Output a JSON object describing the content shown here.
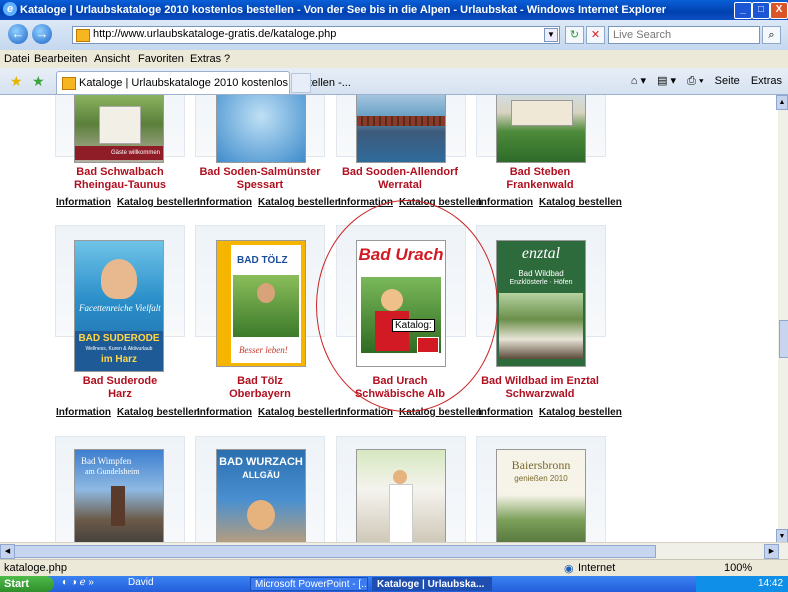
{
  "window": {
    "title": "Kataloge | Urlaubskataloge 2010 kostenlos bestellen - Von der See bis in die Alpen - Urlaubskat - Windows Internet Explorer"
  },
  "address": {
    "url": "http://www.urlaubskataloge-gratis.de/kataloge.php",
    "search_placeholder": "Live Search"
  },
  "menu": [
    "Datei",
    "Bearbeiten",
    "Ansicht",
    "Favoriten",
    "Extras",
    "?"
  ],
  "tab": {
    "label": "Kataloge | Urlaubskataloge 2010 kostenlos bestellen -..."
  },
  "toolbar": {
    "page": "Seite",
    "extras": "Extras"
  },
  "links": {
    "info": "Information",
    "order": "Katalog bestellen"
  },
  "row1": [
    {
      "name1": "Bad Schwalbach",
      "name2": "Rheingau-Taunus"
    },
    {
      "name1": "Bad Soden-Salmünster",
      "name2": "Spessart"
    },
    {
      "name1": "Bad Sooden-Allendorf",
      "name2": "Werratal"
    },
    {
      "name1": "Bad Steben",
      "name2": "Frankenwald"
    }
  ],
  "row2": [
    {
      "name1": "Bad Suderode",
      "name2": "Harz"
    },
    {
      "name1": "Bad Tölz",
      "name2": "Oberbayern"
    },
    {
      "name1": "Bad Urach",
      "name2": "Schwäbische Alb"
    },
    {
      "name1": "Bad Wildbad im Enztal",
      "name2": "Schwarzwald"
    }
  ],
  "covers": {
    "schwalbach_caption": "Gäste willkommen",
    "suderode_title": "BAD SUDERODE",
    "suderode_sub": "Wellness, Kuren & Aktivurlaub",
    "suderode_harz": "im Harz",
    "suderode_script": "Facettenreiche Vielfalt",
    "toelz_title": "BAD TÖLZ",
    "toelz_script": "Besser leben!",
    "urach_title": "Bad Urach",
    "enztal_title": "enztal",
    "enztal_sub1": "Bad Wildbad",
    "enztal_sub2": "Enzklösterle · Höfen",
    "wimpfen_title": "Bad Wimpfen",
    "wimpfen_sub": "am Gundelsheim",
    "wurzach_title": "BAD WURZACH",
    "wurzach_sub": "ALLGÄU",
    "baiers_title": "Baiersbronn",
    "baiers_sub": "genießen 2010"
  },
  "tooltip": "Katalog:",
  "status": {
    "left": "kataloge.php",
    "zone": "Internet",
    "zoom": "100%"
  },
  "taskbar": {
    "start": "Start",
    "user": "David",
    "task1": "Microsoft PowerPoint - [...",
    "task2": "Kataloge | Urlaubska...",
    "clock": "14:42"
  },
  "colors": {
    "name_red": "#b01020",
    "ie_blue": "#0041b0"
  }
}
